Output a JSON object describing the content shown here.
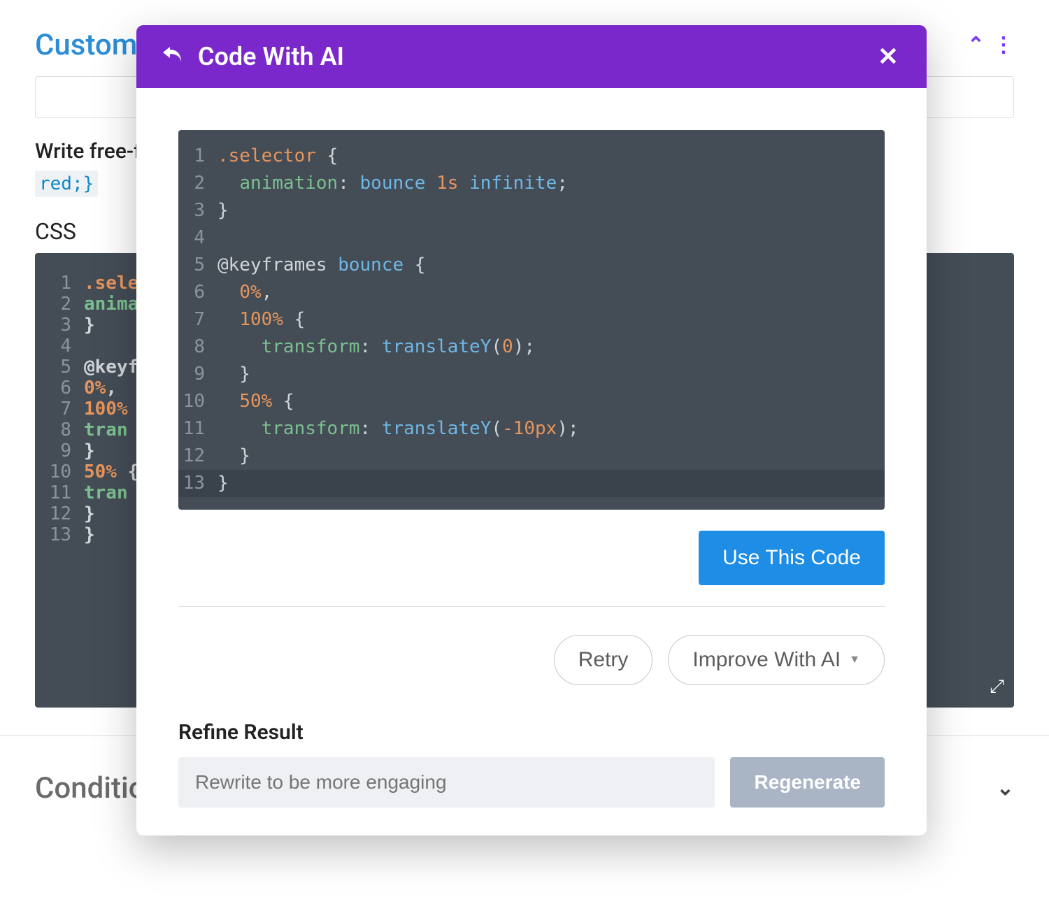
{
  "background": {
    "title": "Custom CSS",
    "help_text": "Write free-form",
    "example_code": "red;}",
    "css_label": "CSS",
    "code_lines": [
      [
        {
          "t": "sel",
          "v": ".selector"
        }
      ],
      [
        {
          "t": "prop",
          "v": "    animati"
        }
      ],
      [
        {
          "t": "brace",
          "v": "}"
        }
      ],
      [],
      [
        {
          "t": "kw",
          "v": "@keyframes"
        }
      ],
      [
        {
          "t": "sel",
          "v": "    0%"
        },
        {
          "t": "brace",
          "v": ","
        }
      ],
      [
        {
          "t": "sel",
          "v": "    100%"
        },
        {
          "t": "brace",
          "v": " {"
        }
      ],
      [
        {
          "t": "prop",
          "v": "        tran"
        }
      ],
      [
        {
          "t": "brace",
          "v": "    }"
        }
      ],
      [
        {
          "t": "sel",
          "v": "    50%"
        },
        {
          "t": "brace",
          "v": " {"
        }
      ],
      [
        {
          "t": "prop",
          "v": "        tran"
        }
      ],
      [
        {
          "t": "brace",
          "v": "    }"
        }
      ],
      [
        {
          "t": "brace",
          "v": "}"
        }
      ]
    ],
    "conditions_label": "Conditions"
  },
  "modal": {
    "title": "Code With AI",
    "use_code_button": "Use This Code",
    "retry_button": "Retry",
    "improve_button": "Improve With AI",
    "refine_label": "Refine Result",
    "refine_placeholder": "Rewrite to be more engaging",
    "regenerate_button": "Regenerate",
    "code_lines": [
      [
        {
          "t": "sel",
          "v": ".selector"
        },
        {
          "t": "punct",
          "v": " {"
        }
      ],
      [
        {
          "t": "punct",
          "v": "  "
        },
        {
          "t": "prop",
          "v": "animation"
        },
        {
          "t": "punct",
          "v": ": "
        },
        {
          "t": "val",
          "v": "bounce"
        },
        {
          "t": "punct",
          "v": " "
        },
        {
          "t": "num",
          "v": "1s"
        },
        {
          "t": "punct",
          "v": " "
        },
        {
          "t": "val",
          "v": "infinite"
        },
        {
          "t": "punct",
          "v": ";"
        }
      ],
      [
        {
          "t": "punct",
          "v": "}"
        }
      ],
      [],
      [
        {
          "t": "kw-at",
          "v": "@keyframes"
        },
        {
          "t": "punct",
          "v": " "
        },
        {
          "t": "val",
          "v": "bounce"
        },
        {
          "t": "punct",
          "v": " {"
        }
      ],
      [
        {
          "t": "punct",
          "v": "  "
        },
        {
          "t": "num",
          "v": "0%"
        },
        {
          "t": "punct",
          "v": ","
        }
      ],
      [
        {
          "t": "punct",
          "v": "  "
        },
        {
          "t": "num",
          "v": "100%"
        },
        {
          "t": "punct",
          "v": " {"
        }
      ],
      [
        {
          "t": "punct",
          "v": "    "
        },
        {
          "t": "prop",
          "v": "transform"
        },
        {
          "t": "punct",
          "v": ": "
        },
        {
          "t": "func",
          "v": "translateY"
        },
        {
          "t": "punct",
          "v": "("
        },
        {
          "t": "num",
          "v": "0"
        },
        {
          "t": "punct",
          "v": ");"
        }
      ],
      [
        {
          "t": "punct",
          "v": "  }"
        }
      ],
      [
        {
          "t": "punct",
          "v": "  "
        },
        {
          "t": "num",
          "v": "50%"
        },
        {
          "t": "punct",
          "v": " {"
        }
      ],
      [
        {
          "t": "punct",
          "v": "    "
        },
        {
          "t": "prop",
          "v": "transform"
        },
        {
          "t": "punct",
          "v": ": "
        },
        {
          "t": "func",
          "v": "translateY"
        },
        {
          "t": "punct",
          "v": "("
        },
        {
          "t": "num",
          "v": "-10px"
        },
        {
          "t": "punct",
          "v": ");"
        }
      ],
      [
        {
          "t": "punct",
          "v": "  }"
        }
      ],
      [
        {
          "t": "punct",
          "v": "}"
        }
      ]
    ],
    "highlight_line": 13
  }
}
